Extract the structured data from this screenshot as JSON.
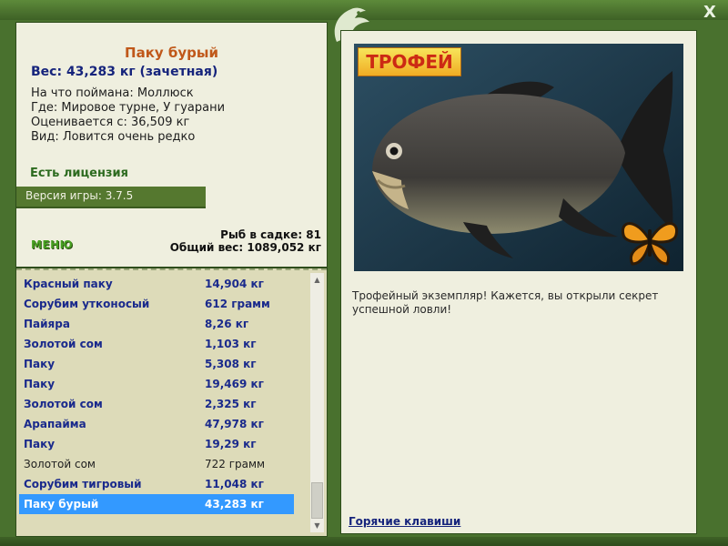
{
  "window": {
    "close_label": "X"
  },
  "fish": {
    "name": "Паку бурый",
    "weight": "Вес: 43,283 кг (зачетная)",
    "caught_on": "На что поймана: Моллюск",
    "location": "Где: Мировое турне, У гуарани",
    "estimated": "Оценивается с: 36,509 кг",
    "rarity": "Вид: Ловится очень редко"
  },
  "license": "Есть лицензия",
  "version": "Версия игры: 3.7.5",
  "menu_label": "МЕНЮ",
  "stats": {
    "fish_in_cage": "Рыб в садке: 81",
    "total_weight": "Общий вес: 1089,052 кг"
  },
  "catch_list": [
    {
      "name": "Красный паку",
      "weight": "14,904 кг",
      "style": "bold"
    },
    {
      "name": "Сорубим утконосый",
      "weight": "612 грамм",
      "style": "bold"
    },
    {
      "name": "Пайяра",
      "weight": "8,26 кг",
      "style": "bold"
    },
    {
      "name": "Золотой сом",
      "weight": "1,103 кг",
      "style": "bold"
    },
    {
      "name": "Паку",
      "weight": "5,308 кг",
      "style": "bold"
    },
    {
      "name": "Паку",
      "weight": "19,469 кг",
      "style": "bold"
    },
    {
      "name": "Золотой сом",
      "weight": "2,325 кг",
      "style": "bold"
    },
    {
      "name": "Арапайма",
      "weight": "47,978 кг",
      "style": "bold"
    },
    {
      "name": "Паку",
      "weight": "19,29 кг",
      "style": "bold"
    },
    {
      "name": "Золотой сом",
      "weight": "722 грамм",
      "style": "normal"
    },
    {
      "name": "Сорубим тигровый",
      "weight": "11,048 кг",
      "style": "bold"
    },
    {
      "name": "Паку бурый",
      "weight": "43,283 кг",
      "style": "selected"
    }
  ],
  "trophy": {
    "badge": "ТРОФЕЙ",
    "description": "Трофейный экземпляр! Кажется, вы открыли секрет успешной ловли!"
  },
  "hotkeys": "Горячие клавиши",
  "colors": {
    "frame": "#49712e",
    "panel": "#efefdf",
    "list_bg": "#dddbb9",
    "selected_row": "#3399ff",
    "title_orange": "#c0581a",
    "navy": "#16247c"
  }
}
